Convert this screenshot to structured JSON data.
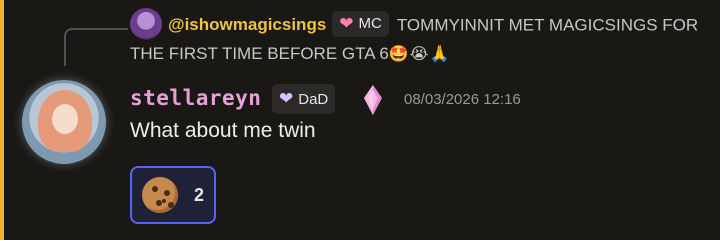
{
  "reply": {
    "author": "@ishowmagicsings",
    "tag_label": "MC",
    "text": "TOMMYINNIT MET MAGICSINGS FOR THE FIRST TIME BEFORE GTA 6",
    "emojis": "🤩😭🙏"
  },
  "message": {
    "username": "stellareyn",
    "tag_label": "DaD",
    "timestamp": "08/03/2026 12:16",
    "text": "What about me twin"
  },
  "reaction": {
    "emoji_icon": "cookie-icon",
    "count": "2"
  },
  "colors": {
    "mention_bar": "#f0b232",
    "username": "#e9a0d8",
    "reply_author": "#f0c33c",
    "reaction_border": "#5865f2"
  }
}
